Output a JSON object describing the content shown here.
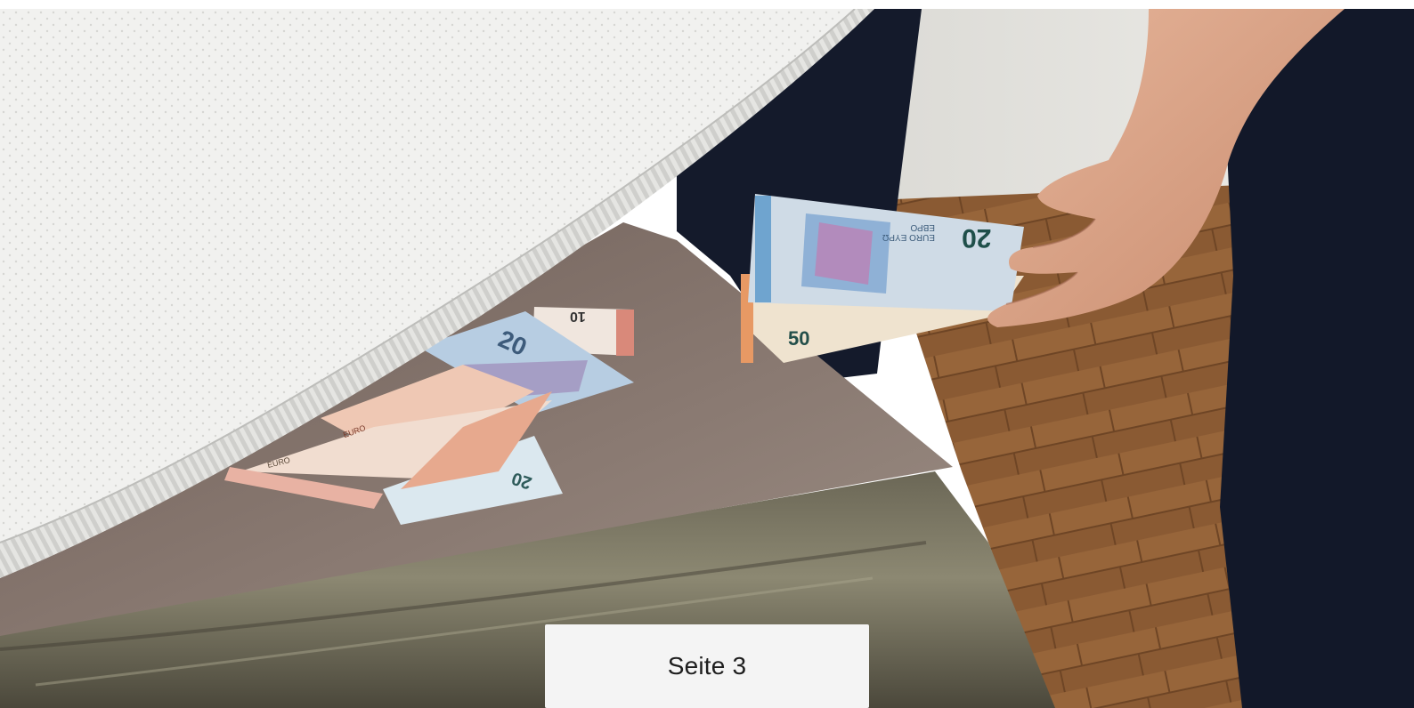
{
  "image": {
    "alt_subject": "hand-holding-banknotes-mattress-photo"
  },
  "banknotes": {
    "hand_held": [
      {
        "value_label": "20",
        "text_line": "EURO ΕΥΡΩ ЕВРО"
      },
      {
        "value_label": "50"
      }
    ],
    "on_bed": [
      {
        "value_label": "10"
      },
      {
        "value_label": "20"
      },
      {
        "value_label": "20"
      },
      {
        "value_label": "EURO"
      },
      {
        "value_label": "EURO"
      }
    ]
  },
  "pagination": {
    "label": "Seite 3"
  },
  "colors": {
    "mattress": "#f0f0ee",
    "sheet": "#7e6e66",
    "satin": "#5e5a4a",
    "wall": "#e9e8e4",
    "floor": "#8a5b33",
    "jeans": "#141a2b",
    "skin": "#d9a58a",
    "label_bg": "#f4f4f4"
  }
}
